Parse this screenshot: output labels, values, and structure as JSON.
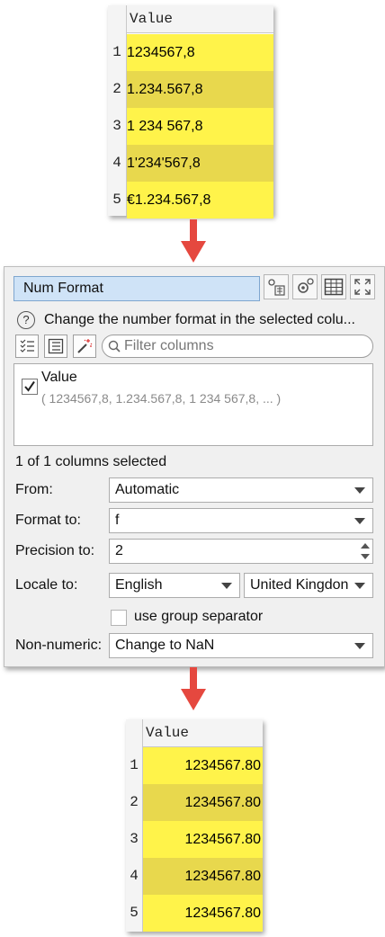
{
  "input_table": {
    "header": "Value",
    "rows": [
      {
        "num": "1",
        "value": "1234567,8"
      },
      {
        "num": "2",
        "value": "1.234.567,8"
      },
      {
        "num": "3",
        "value": "1 234 567,8"
      },
      {
        "num": "4",
        "value": "1'234'567,8"
      },
      {
        "num": "5",
        "value": "€1.234.567,8"
      }
    ]
  },
  "panel": {
    "title": "Num Format",
    "help_text": "Change the number format in the selected colu...",
    "filter_placeholder": "Filter columns",
    "column": {
      "name": "Value",
      "sample": "( 1234567,8, 1.234.567,8, 1 234 567,8, ... )"
    },
    "status": "1 of 1 columns selected",
    "from": {
      "label": "From:",
      "value": "Automatic"
    },
    "format_to": {
      "label": "Format to:",
      "value": "f"
    },
    "precision_to": {
      "label": "Precision to:",
      "value": "2"
    },
    "locale_to": {
      "label": "Locale to:",
      "language": "English",
      "country": "United Kingdon"
    },
    "group_separator": {
      "label": "use group separator"
    },
    "non_numeric": {
      "label": "Non-numeric:",
      "value": "Change to NaN"
    }
  },
  "output_table": {
    "header": "Value",
    "rows": [
      {
        "num": "1",
        "value": "1234567.80"
      },
      {
        "num": "2",
        "value": "1234567.80"
      },
      {
        "num": "3",
        "value": "1234567.80"
      },
      {
        "num": "4",
        "value": "1234567.80"
      },
      {
        "num": "5",
        "value": "1234567.80"
      }
    ]
  },
  "colors": {
    "cell_yellow": "#fff34a",
    "cell_dark_yellow": "#e8d84d",
    "arrow_red": "#e5483f",
    "title_blue": "#cfe3f7"
  }
}
